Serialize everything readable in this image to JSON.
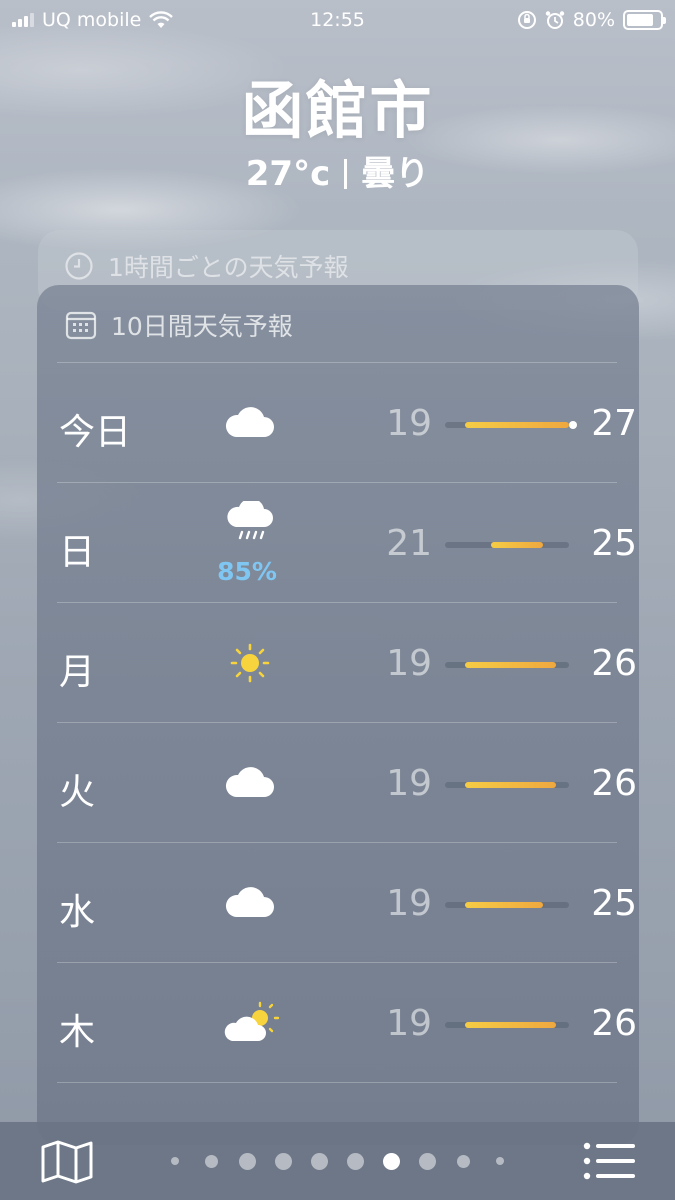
{
  "status": {
    "carrier": "UQ mobile",
    "time": "12:55",
    "battery": "80%",
    "battery_level": 0.8
  },
  "header": {
    "city": "函館市",
    "temperature": "27°c",
    "condition": "曇り"
  },
  "hourly": {
    "title": "1時間ごとの天気予報",
    "icon": "clock-icon"
  },
  "daily": {
    "title": "10日間天気予報",
    "icon": "calendar-icon",
    "range_min": 19,
    "range_max": 27,
    "days": [
      {
        "day": "今日",
        "icon": "cloud-icon",
        "pop": "",
        "low": "19",
        "high": "27",
        "current_temp": 27
      },
      {
        "day": "日",
        "icon": "cloud-rain-icon",
        "pop": "85%",
        "low": "21",
        "high": "25"
      },
      {
        "day": "月",
        "icon": "sun-icon",
        "pop": "",
        "low": "19",
        "high": "26"
      },
      {
        "day": "火",
        "icon": "cloud-icon",
        "pop": "",
        "low": "19",
        "high": "26"
      },
      {
        "day": "水",
        "icon": "cloud-icon",
        "pop": "",
        "low": "19",
        "high": "25"
      },
      {
        "day": "木",
        "icon": "cloud-sun-icon",
        "pop": "",
        "low": "19",
        "high": "26"
      }
    ]
  },
  "pager": {
    "count": 10,
    "active_index": 6
  },
  "colors": {
    "bar_start": "#f5cc45",
    "bar_end": "#efa83f",
    "pop_blue": "#7fc6f2"
  }
}
